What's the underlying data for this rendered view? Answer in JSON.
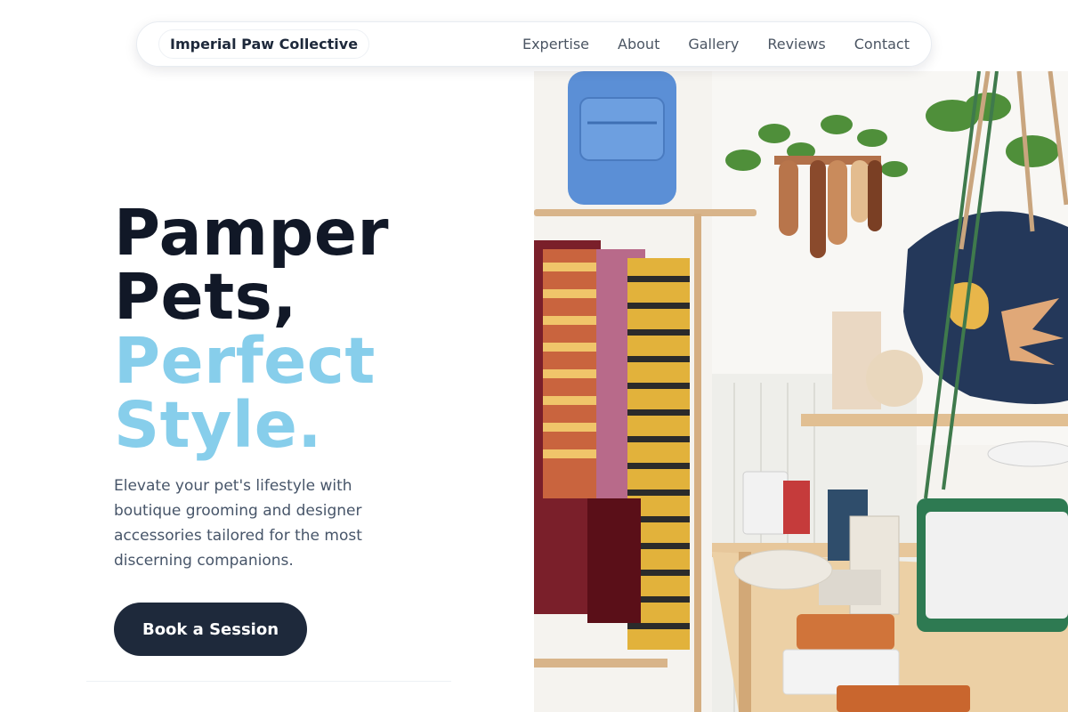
{
  "nav": {
    "brand": "Imperial Paw Collective",
    "links": [
      "Expertise",
      "About",
      "Gallery",
      "Reviews",
      "Contact"
    ]
  },
  "hero": {
    "headline_line1": "Pamper",
    "headline_line2": "Pets,",
    "headline_line3": "Perfect",
    "headline_line4": "Style.",
    "subtext": "Elevate your pet's lifestyle with boutique grooming and designer accessories tailored for the most discerning companions.",
    "cta_label": "Book a Session"
  },
  "colors": {
    "dark": "#111827",
    "accent": "#87ceeb",
    "button": "#1e293b"
  }
}
